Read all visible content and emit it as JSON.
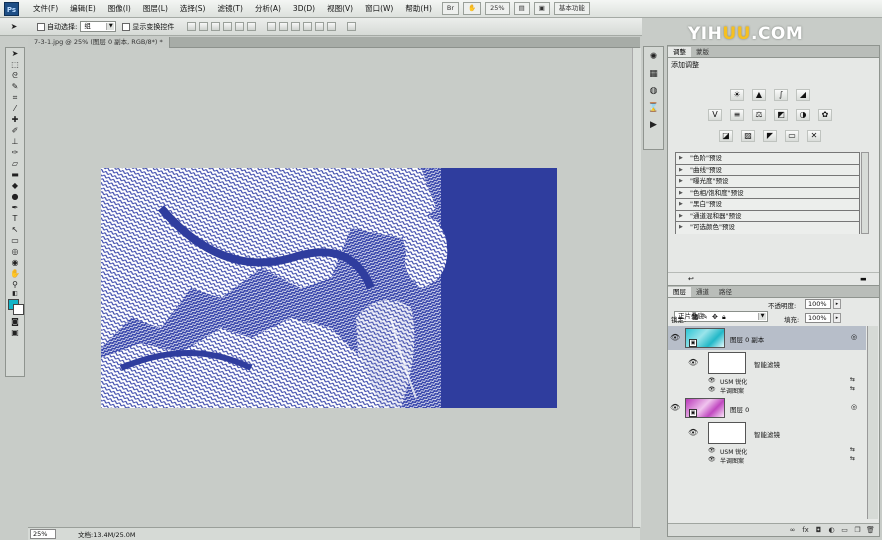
{
  "app": {
    "logo": "Ps"
  },
  "menu": [
    "文件(F)",
    "编辑(E)",
    "图像(I)",
    "图层(L)",
    "选择(S)",
    "滤镜(T)",
    "分析(A)",
    "3D(D)",
    "视图(V)",
    "窗口(W)",
    "帮助(H)"
  ],
  "menubar_right": {
    "zoom": "25%",
    "workspace": "基本功能"
  },
  "options": {
    "auto_select_label": "自动选择:",
    "auto_select_value": "组",
    "show_transform_label": "显示变换控件"
  },
  "document": {
    "tab_title": "7-3-1.jpg @ 25% (图层 0 副本, RGB/8*) *",
    "zoom": "25%",
    "doc_info": "文档:13.4M/25.0M"
  },
  "watermark": {
    "part1": "YIH",
    "part2": "UU",
    "part3": ".COM"
  },
  "adjustments": {
    "tabs": [
      "调整",
      "蒙版"
    ],
    "title": "添加调整",
    "icons_row1": [
      "brightness-icon",
      "levels-icon",
      "curves-icon",
      "exposure-icon"
    ],
    "icons_row2": [
      "vibrance-icon",
      "hue-saturation-icon",
      "color-balance-icon",
      "black-white-icon",
      "photo-filter-icon",
      "channel-mixer-icon"
    ],
    "icons_row3": [
      "invert-icon",
      "posterize-icon",
      "threshold-icon",
      "gradient-map-icon",
      "selective-color-icon"
    ],
    "presets": [
      "\"色阶\"预设",
      "\"曲线\"预设",
      "\"曝光度\"预设",
      "\"色相/饱和度\"预设",
      "\"黑白\"预设",
      "\"通道混和器\"预设",
      "\"可选颜色\"预设"
    ]
  },
  "layers": {
    "tabs": [
      "图层",
      "通道",
      "路径"
    ],
    "blend_mode": "正片叠底",
    "opacity_label": "不透明度:",
    "opacity_value": "100%",
    "lock_label": "锁定:",
    "fill_label": "填充:",
    "fill_value": "100%",
    "items": [
      {
        "name": "图层 0 副本",
        "smart_filters": "智能滤镜",
        "filters": [
          "USM 锐化",
          "半调图案"
        ],
        "selected": true
      },
      {
        "name": "图层 0",
        "smart_filters": "智能滤镜",
        "filters": [
          "USM 锐化",
          "半调图案"
        ],
        "selected": false
      }
    ]
  },
  "colors": {
    "accent_blue": "#2c3aa0",
    "fg_swatch": "#12b4c8",
    "thumb_cyan": "#22b8c8",
    "thumb_magenta": "#c048c0"
  }
}
